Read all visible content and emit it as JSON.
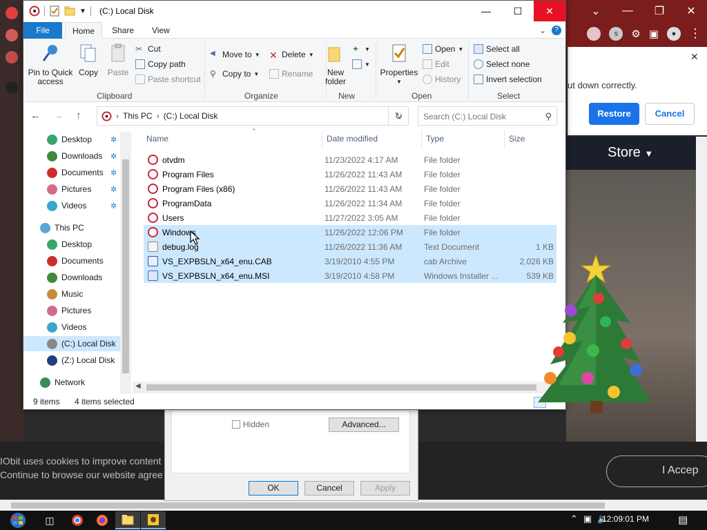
{
  "explorer": {
    "window_title": "(C:) Local Disk",
    "ribbon_tabs": [
      "File",
      "Home",
      "Share",
      "View"
    ],
    "clipboard": {
      "pin_label_1": "Pin to Quick",
      "pin_label_2": "access",
      "copy": "Copy",
      "paste": "Paste",
      "cut": "Cut",
      "copy_path": "Copy path",
      "paste_shortcut": "Paste shortcut",
      "group": "Clipboard"
    },
    "organize": {
      "move_to": "Move to",
      "copy_to": "Copy to",
      "delete": "Delete",
      "rename": "Rename",
      "group": "Organize"
    },
    "new": {
      "new_folder_1": "New",
      "new_folder_2": "folder",
      "group": "New"
    },
    "open": {
      "properties": "Properties",
      "open": "Open",
      "edit": "Edit",
      "history": "History",
      "group": "Open"
    },
    "select": {
      "select_all": "Select all",
      "select_none": "Select none",
      "invert_selection": "Invert selection",
      "group": "Select"
    },
    "address": {
      "crumb_1": "This PC",
      "crumb_2": "(C:) Local Disk"
    },
    "search_placeholder": "Search (C:) Local Disk",
    "nav_pane": [
      {
        "label": "Desktop",
        "color": "#3aa66b",
        "pinned": true
      },
      {
        "label": "Downloads",
        "color": "#3d8a3d",
        "pinned": true
      },
      {
        "label": "Documents",
        "color": "#c9302c",
        "pinned": true
      },
      {
        "label": "Pictures",
        "color": "#d46a8a",
        "pinned": true
      },
      {
        "label": "Videos",
        "color": "#36a7c9",
        "pinned": true
      },
      {
        "label": "This PC",
        "color": "#5aa7d6",
        "pinned": false
      },
      {
        "label": "Desktop",
        "color": "#3aa66b",
        "pinned": false
      },
      {
        "label": "Documents",
        "color": "#c9302c",
        "pinned": false
      },
      {
        "label": "Downloads",
        "color": "#3d8a3d",
        "pinned": false
      },
      {
        "label": "Music",
        "color": "#c98a3a",
        "pinned": false
      },
      {
        "label": "Pictures",
        "color": "#d46a8a",
        "pinned": false
      },
      {
        "label": "Videos",
        "color": "#36a7c9",
        "pinned": false
      },
      {
        "label": "(C:) Local Disk",
        "color": "#888888",
        "pinned": false
      },
      {
        "label": "(Z:) Local Disk",
        "color": "#1f3f7a",
        "pinned": false
      },
      {
        "label": "Network",
        "color": "#3a8a5a",
        "pinned": false
      }
    ],
    "columns": [
      "Name",
      "Date modified",
      "Type",
      "Size"
    ],
    "files": [
      {
        "name": "otvdm",
        "date": "11/23/2022 4:17 AM",
        "type": "File folder",
        "size": "",
        "icon": "folder"
      },
      {
        "name": "Program Files",
        "date": "11/26/2022 11:43 AM",
        "type": "File folder",
        "size": "",
        "icon": "folder"
      },
      {
        "name": "Program Files (x86)",
        "date": "11/26/2022 11:43 AM",
        "type": "File folder",
        "size": "",
        "icon": "folder"
      },
      {
        "name": "ProgramData",
        "date": "11/26/2022 11:34 AM",
        "type": "File folder",
        "size": "",
        "icon": "folder"
      },
      {
        "name": "Users",
        "date": "11/27/2022 3:05 AM",
        "type": "File folder",
        "size": "",
        "icon": "folder"
      },
      {
        "name": "Windows",
        "date": "11/26/2022 12:06 PM",
        "type": "File folder",
        "size": "",
        "icon": "folder"
      },
      {
        "name": "debug.log",
        "date": "11/26/2022 11:36 AM",
        "type": "Text Document",
        "size": "1 KB",
        "icon": "txt"
      },
      {
        "name": "VS_EXPBSLN_x64_enu.CAB",
        "date": "3/19/2010 4:55 PM",
        "type": "cab Archive",
        "size": "2,026 KB",
        "icon": "cab"
      },
      {
        "name": "VS_EXPBSLN_x64_enu.MSI",
        "date": "3/19/2010 4:58 PM",
        "type": "Windows Installer ...",
        "size": "539 KB",
        "icon": "msi"
      }
    ],
    "selected_rows": [
      5,
      6,
      7,
      8
    ],
    "status": {
      "count": "9 items",
      "selected": "4 items selected"
    }
  },
  "browser": {
    "restore_message": "ut down correctly.",
    "restore_button": "Restore",
    "cancel_button": "Cancel",
    "store_link": "Store",
    "cookie_line_1": "IObit uses cookies to improve content",
    "cookie_line_2": "Continue to browse our website agree",
    "accept_button": "I Accep",
    "extension_label": "s"
  },
  "properties_dialog": {
    "hidden_label": "Hidden",
    "advanced_button": "Advanced...",
    "ok_button": "OK",
    "cancel_button": "Cancel",
    "apply_button": "Apply"
  },
  "taskbar": {
    "clock": "12:09:01 PM"
  },
  "colors": {
    "accent": "#1979ca",
    "selection": "#cce8ff",
    "close": "#e81123"
  }
}
